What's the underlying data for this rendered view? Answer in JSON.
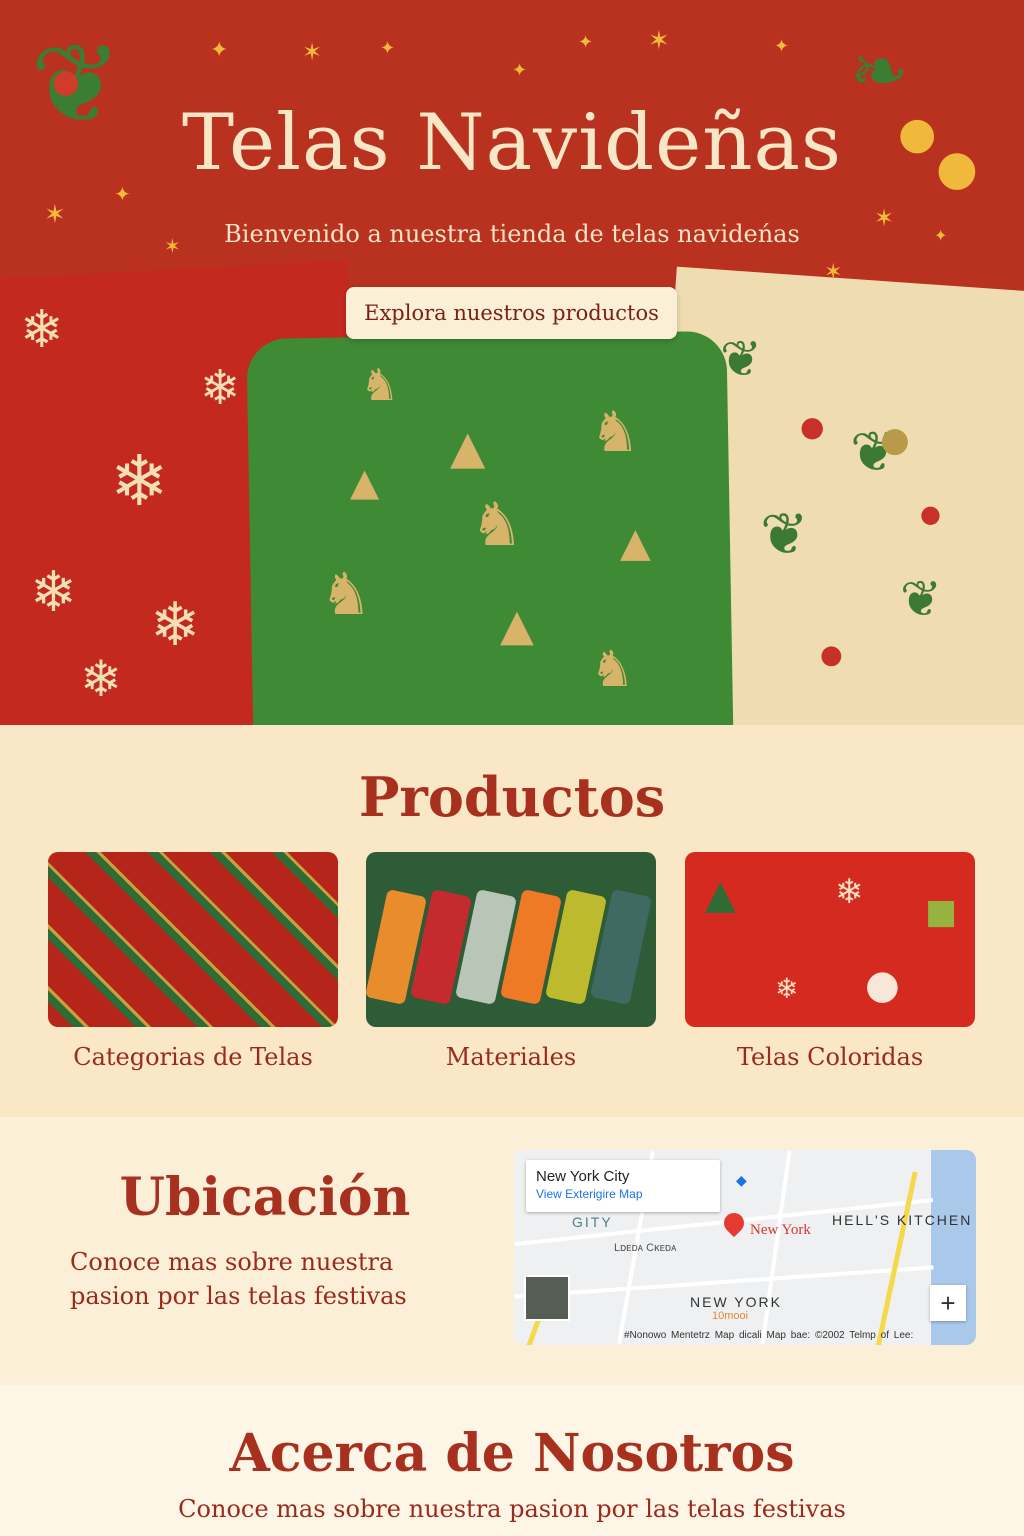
{
  "hero": {
    "title": "Telas Navideñas",
    "subtitle": "Bienvenido a nuestra tienda de telas navideńas",
    "cta_label": "Explora nuestros productos",
    "background_color": "#b8321f"
  },
  "products": {
    "title": "Productos",
    "items": [
      {
        "label": "Categorias de Telas",
        "image": "plaid-fabric"
      },
      {
        "label": "Materiales",
        "image": "thread-spools"
      },
      {
        "label": "Telas Coloridas",
        "image": "festive-print-fabric"
      }
    ]
  },
  "location": {
    "title": "Ubicación",
    "text": "Conoce mas sobre nuestra pasion por las telas festivas",
    "map": {
      "place_name": "New York City",
      "link_label": "View Exterigire Map",
      "pin_label": "New York",
      "labels": [
        "GITY",
        "HELL'S KITCHEN",
        "NEW YORK"
      ],
      "small_labels": [
        "10mooi",
        "Lᴅᴇᴅᴀ Cᴋᴇᴅᴀ"
      ],
      "footer": "#Nonowo Mentetrz   Map dicali   Map bae: ©2002   Telmp of Lee:",
      "zoom_in": "+"
    }
  },
  "about": {
    "title": "Acerca de Nosotros",
    "text": "Conoce mas sobre nuestra pasion por las telas festivas"
  },
  "colors": {
    "accent_red": "#a8301f",
    "cream": "#f9e7c6",
    "gold": "#f1b93b",
    "green": "#3f8a34"
  }
}
